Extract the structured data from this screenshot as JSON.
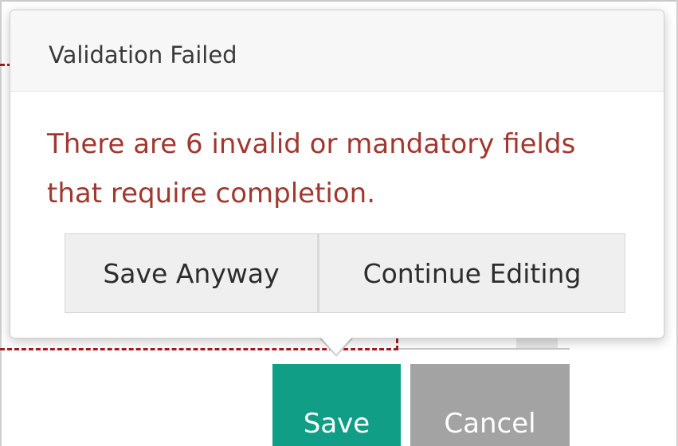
{
  "popover": {
    "title": "Validation Failed",
    "message": "There are 6 invalid or mandatory fields that require completion.",
    "save_anyway_label": "Save Anyway",
    "continue_editing_label": "Continue Editing"
  },
  "form_actions": {
    "save_label": "Save",
    "cancel_label": "Cancel"
  },
  "colors": {
    "message_text": "#a0382f",
    "save_button": "#119e86",
    "cancel_button": "#a3a3a3",
    "invalid_field_border": "#a01e1e"
  }
}
